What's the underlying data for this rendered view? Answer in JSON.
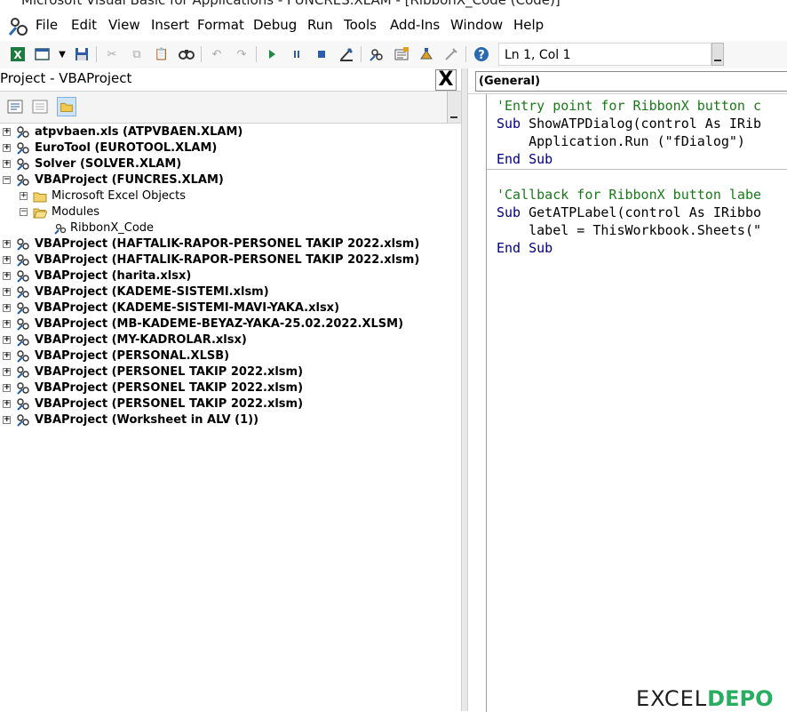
{
  "window": {
    "title": "Microsoft Visual Basic for Applications - FUNCRES.XLAM - [RibbonX_Code (Code)]"
  },
  "menu": {
    "items": [
      {
        "label": "File"
      },
      {
        "label": "Edit"
      },
      {
        "label": "View"
      },
      {
        "label": "Insert"
      },
      {
        "label": "Format"
      },
      {
        "label": "Debug"
      },
      {
        "label": "Run"
      },
      {
        "label": "Tools"
      },
      {
        "label": "Add-Ins"
      },
      {
        "label": "Window"
      },
      {
        "label": "Help"
      }
    ]
  },
  "toolbar": {
    "position": "Ln 1, Col 1"
  },
  "project": {
    "title": "Project - VBAProject",
    "close_label": "X",
    "tree": [
      {
        "label": "atpvbaen.xls (ATPVBAEN.XLAM)"
      },
      {
        "label": "EuroTool (EUROTOOL.XLAM)"
      },
      {
        "label": "Solver (SOLVER.XLAM)"
      },
      {
        "label": "VBAProject (FUNCRES.XLAM)"
      },
      {
        "label": "Microsoft Excel Objects"
      },
      {
        "label": "Modules"
      },
      {
        "label": "RibbonX_Code"
      },
      {
        "label": "VBAProject (HAFTALIK-RAPOR-PERSONEL TAKIP 2022.xlsm)"
      },
      {
        "label": "VBAProject (HAFTALIK-RAPOR-PERSONEL TAKIP 2022.xlsm)"
      },
      {
        "label": "VBAProject (harita.xlsx)"
      },
      {
        "label": "VBAProject (KADEME-SISTEMI.xlsm)"
      },
      {
        "label": "VBAProject (KADEME-SISTEMI-MAVI-YAKA.xlsx)"
      },
      {
        "label": "VBAProject (MB-KADEME-BEYAZ-YAKA-25.02.2022.XLSM)"
      },
      {
        "label": "VBAProject (MY-KADROLAR.xlsx)"
      },
      {
        "label": "VBAProject (PERSONAL.XLSB)"
      },
      {
        "label": "VBAProject (PERSONEL TAKIP 2022.xlsm)"
      },
      {
        "label": "VBAProject (PERSONEL TAKIP 2022.xlsm)"
      },
      {
        "label": "VBAProject (PERSONEL TAKIP 2022.xlsm)"
      },
      {
        "label": "VBAProject (Worksheet in ALV (1))"
      }
    ]
  },
  "code": {
    "object_combo": "(General)",
    "lines": [
      {
        "text": "'Entry point for RibbonX button c"
      },
      {
        "kw": "Sub ",
        "text": "ShowATPDialog(control As IRib"
      },
      {
        "text": "    Application.Run (\"fDialog\")"
      },
      {
        "kw": "End Sub"
      },
      {
        "text": "'Callback for RibbonX button labe"
      },
      {
        "kw": "Sub ",
        "text": "GetATPLabel(control As IRibbo"
      },
      {
        "text": "    label = ThisWorkbook.Sheets(\""
      },
      {
        "kw": "End Sub"
      }
    ]
  },
  "watermark": {
    "part1": "EXCEL",
    "part2": "DEPO"
  },
  "icons": {
    "app": "vba-app-icon",
    "excel": "excel-icon",
    "insert_userform": "insert-userform-icon",
    "save": "save-icon",
    "cut": "cut-icon",
    "copy": "copy-icon",
    "paste": "paste-icon",
    "find": "find-icon",
    "undo": "undo-icon",
    "redo": "redo-icon",
    "run": "run-icon",
    "break": "break-icon",
    "reset": "reset-icon",
    "design_mode": "design-mode-icon",
    "project_explorer": "project-explorer-icon",
    "properties": "properties-icon",
    "object_browser": "object-browser-icon",
    "toolbox": "toolbox-icon",
    "help": "help-icon"
  },
  "colors": {
    "comment": "#1a7a1a",
    "keyword": "#00007f",
    "watermark_green": "#27ae60"
  }
}
